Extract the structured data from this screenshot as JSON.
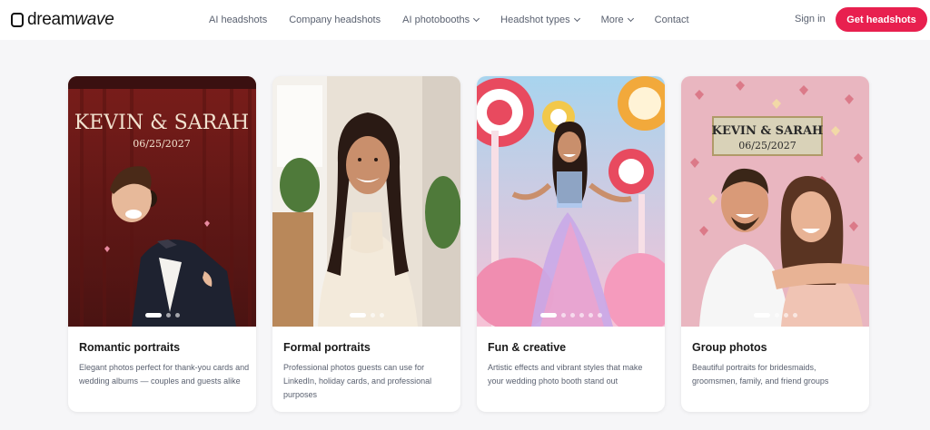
{
  "header": {
    "logo_text_plain": "dream",
    "logo_text_italic": "wave",
    "nav": [
      {
        "label": "AI headshots",
        "dropdown": false
      },
      {
        "label": "Company headshots",
        "dropdown": false
      },
      {
        "label": "AI photobooths",
        "dropdown": true
      },
      {
        "label": "Headshot types",
        "dropdown": true
      },
      {
        "label": "More",
        "dropdown": true
      },
      {
        "label": "Contact",
        "dropdown": false
      }
    ],
    "signin_label": "Sign in",
    "cta_label": "Get headshots",
    "cta_color": "#e8204f"
  },
  "cards": [
    {
      "title": "Romantic portraits",
      "description": "Elegant photos perfect for thank-you cards and wedding albums — couples and guests alike",
      "sign_names": "KEVIN & SARAH",
      "sign_date": "06/25/2027",
      "slide_count": 3,
      "active_slide": 1
    },
    {
      "title": "Formal portraits",
      "description": "Professional photos guests can use for LinkedIn, holiday cards, and professional purposes",
      "slide_count": 3,
      "active_slide": 1
    },
    {
      "title": "Fun & creative",
      "description": "Artistic effects and vibrant styles that make your wedding photo booth stand out",
      "slide_count": 6,
      "active_slide": 1
    },
    {
      "title": "Group photos",
      "description": "Beautiful portraits for bridesmaids, groomsmen, family, and friend groups",
      "sign_names": "KEVIN & SARAH",
      "sign_date": "06/25/2027",
      "slide_count": 4,
      "active_slide": 1
    }
  ]
}
